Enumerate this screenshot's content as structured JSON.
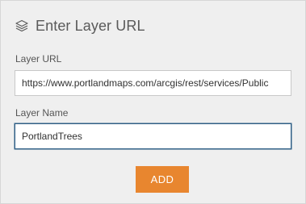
{
  "header": {
    "icon": "layers-icon",
    "title": "Enter Layer URL"
  },
  "form": {
    "url_label": "Layer URL",
    "url_value": "https://www.portlandmaps.com/arcgis/rest/services/Public",
    "name_label": "Layer Name",
    "name_value": "PortlandTrees",
    "add_button_label": "ADD"
  },
  "colors": {
    "panel_bg": "#efefef",
    "accent_button": "#e8862f",
    "focus_border": "#2f5f86"
  }
}
